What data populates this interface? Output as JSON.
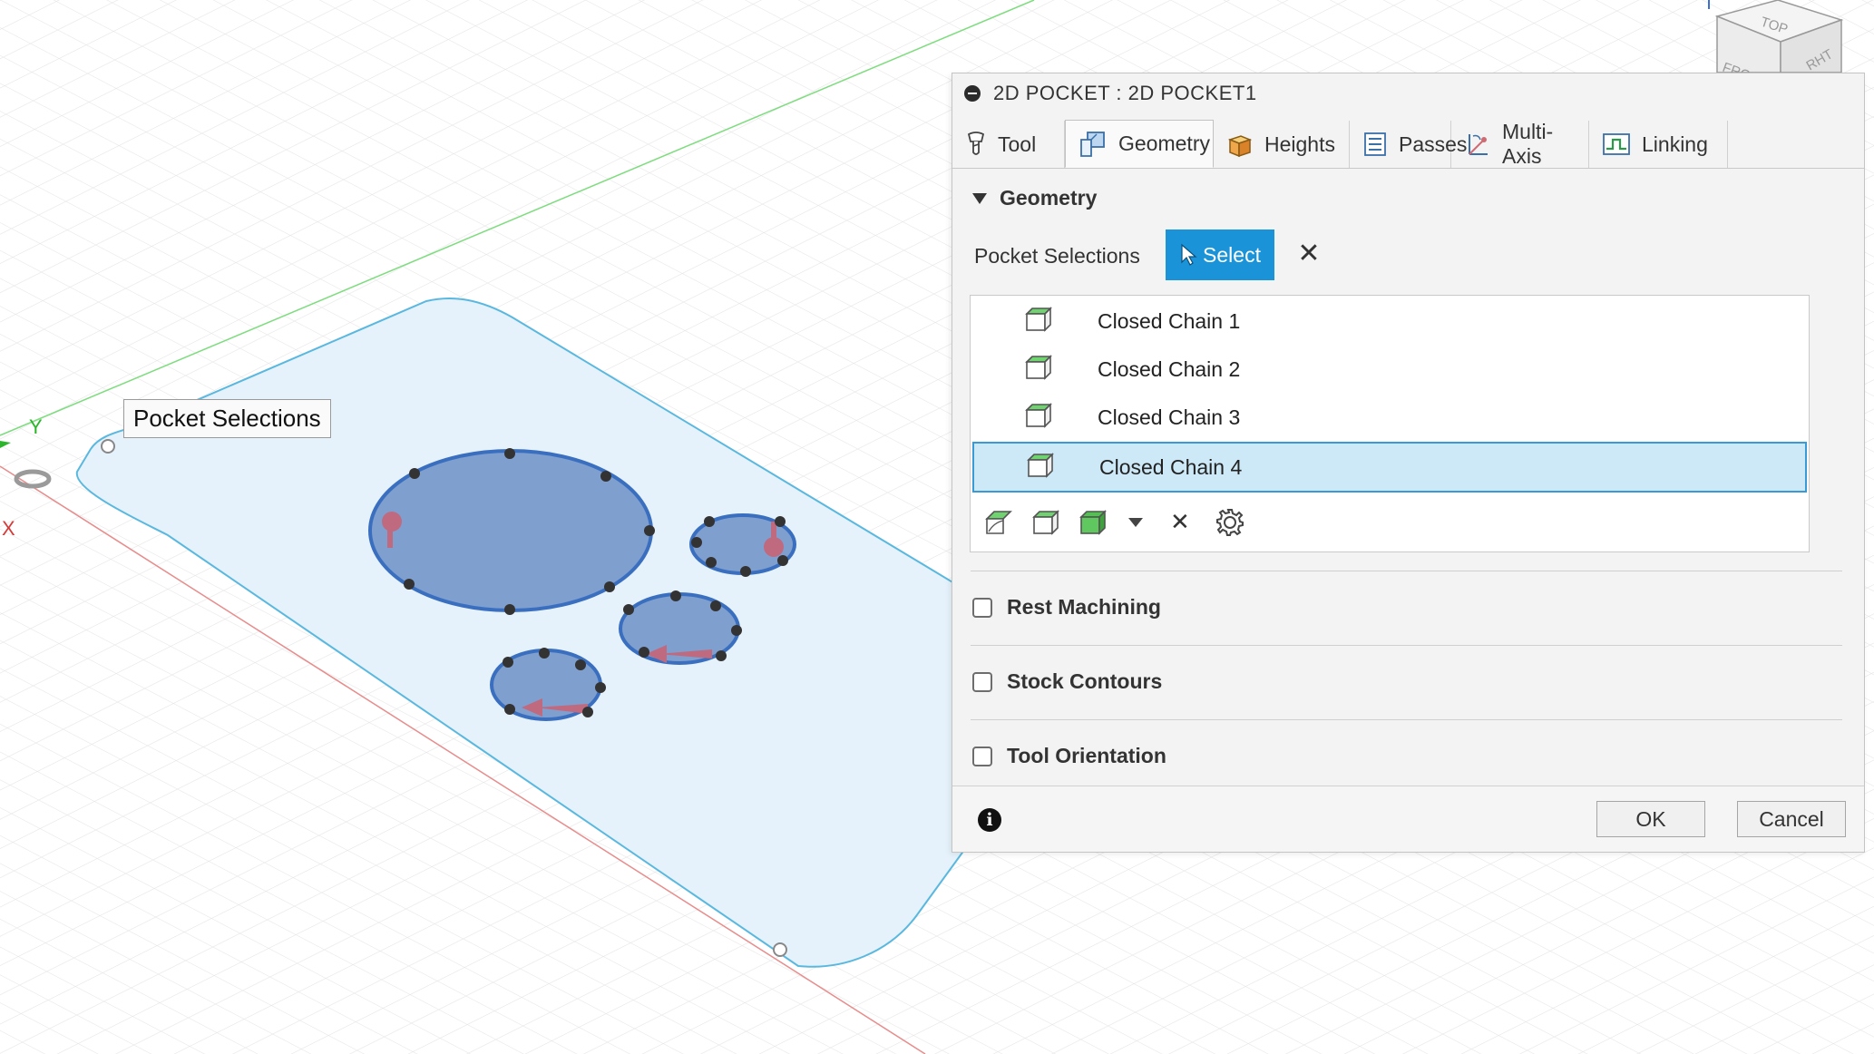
{
  "viewport": {
    "axis_x_label": "X",
    "axis_y_label": "Y",
    "tooltip": "Pocket Selections",
    "viewcube_faces": [
      "TOP",
      "FRO",
      "RHT"
    ]
  },
  "dialog": {
    "title": "2D POCKET : 2D POCKET1",
    "tabs": [
      {
        "label": "Tool",
        "icon": "tool-icon"
      },
      {
        "label": "Geometry",
        "icon": "geometry-icon"
      },
      {
        "label": "Heights",
        "icon": "heights-icon"
      },
      {
        "label": "Passes",
        "icon": "passes-icon"
      },
      {
        "label": "Multi-Axis",
        "icon": "multi-axis-icon"
      },
      {
        "label": "Linking",
        "icon": "linking-icon"
      }
    ],
    "active_tab": "Geometry",
    "geometry_section": {
      "title": "Geometry",
      "pocket_selections_label": "Pocket Selections",
      "select_label": "Select",
      "items": [
        "Closed Chain 1",
        "Closed Chain 2",
        "Closed Chain 3",
        "Closed Chain 4"
      ],
      "selected_item": "Closed Chain 4"
    },
    "options": {
      "rest_machining": "Rest Machining",
      "stock_contours": "Stock Contours",
      "tool_orientation": "Tool Orientation"
    },
    "footer": {
      "ok_label": "OK",
      "cancel_label": "Cancel"
    }
  },
  "colors": {
    "accent": "#1b93d9",
    "selection_bg": "#cde8f6",
    "face_fill": "#e6f2fb",
    "face_edge": "#5ab8df",
    "pocket_fill": "#7f9fcf",
    "pocket_edge": "#3a6fc0",
    "arrow": "#d06a72"
  }
}
